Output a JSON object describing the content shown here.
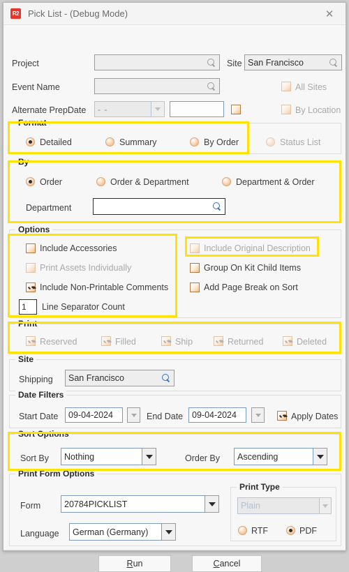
{
  "window": {
    "title": "Pick List - (Debug Mode)",
    "app_icon": "R2",
    "close_icon": "close-icon"
  },
  "top": {
    "project_label": "Project",
    "project_value": "",
    "event_label": "Event Name",
    "event_value": "",
    "altdate_label": "Alternate PrepDate",
    "altdate_value": "-  -",
    "altdate_second_value": "",
    "site_label": "Site",
    "site_value": "San Francisco",
    "all_sites_label": "All Sites",
    "by_location_label": "By Location"
  },
  "format": {
    "caption": "Format",
    "options": [
      {
        "label": "Detailed",
        "selected": true,
        "disabled": false
      },
      {
        "label": "Summary",
        "selected": false,
        "disabled": false
      },
      {
        "label": "By Order",
        "selected": false,
        "disabled": false
      },
      {
        "label": "Status List",
        "selected": false,
        "disabled": true
      }
    ]
  },
  "by": {
    "caption": "By",
    "options": [
      {
        "label": "Order",
        "selected": true
      },
      {
        "label": "Order & Department",
        "selected": false
      },
      {
        "label": "Department & Order",
        "selected": false
      }
    ],
    "department_label": "Department",
    "department_value": ""
  },
  "options": {
    "caption": "Options",
    "left": [
      {
        "label": "Include Accessories",
        "checked": false,
        "disabled": false
      },
      {
        "label": "Print Assets Individually",
        "checked": false,
        "disabled": true
      },
      {
        "label": "Include Non-Printable Comments",
        "checked": true,
        "disabled": false
      }
    ],
    "right": [
      {
        "label": "Include Original Description",
        "checked": false,
        "disabled": true
      },
      {
        "label": "Group On Kit Child Items",
        "checked": false,
        "disabled": false
      },
      {
        "label": "Add Page Break on Sort",
        "checked": false,
        "disabled": false
      }
    ],
    "line_separator_value": "1",
    "line_separator_label": "Line Separator Count"
  },
  "print": {
    "caption": "Print",
    "items": [
      {
        "label": "Reserved",
        "checked": true,
        "disabled": true
      },
      {
        "label": "Filled",
        "checked": true,
        "disabled": true
      },
      {
        "label": "Ship",
        "checked": true,
        "disabled": true
      },
      {
        "label": "Returned",
        "checked": true,
        "disabled": true
      },
      {
        "label": "Deleted",
        "checked": true,
        "disabled": true
      }
    ]
  },
  "site_group": {
    "caption": "Site",
    "shipping_label": "Shipping",
    "shipping_value": "San Francisco"
  },
  "date_filters": {
    "caption": "Date Filters",
    "start_label": "Start Date",
    "start_value": "09-04-2024",
    "end_label": "End Date",
    "end_value": "09-04-2024",
    "apply_label": "Apply Dates",
    "apply_checked": true
  },
  "sort_options": {
    "caption": "Sort Options",
    "sort_by_label": "Sort By",
    "sort_by_value": "Nothing",
    "order_by_label": "Order By",
    "order_by_value": "Ascending"
  },
  "print_form_options": {
    "caption": "Print Form Options",
    "form_label": "Form",
    "form_value": "20784PICKLIST",
    "language_label": "Language",
    "language_value": "German (Germany)",
    "print_type": {
      "caption": "Print Type",
      "type_value": "Plain",
      "rtf_label": "RTF",
      "rtf_selected": false,
      "pdf_label": "PDF",
      "pdf_selected": true
    }
  },
  "footer": {
    "run_accel": "R",
    "run_rest": "un",
    "cancel_accel": "C",
    "cancel_rest": "ancel"
  },
  "colors": {
    "highlight": "#ffe300",
    "accent_checkbox": "#f7bf85",
    "app_icon": "#e8342a"
  }
}
